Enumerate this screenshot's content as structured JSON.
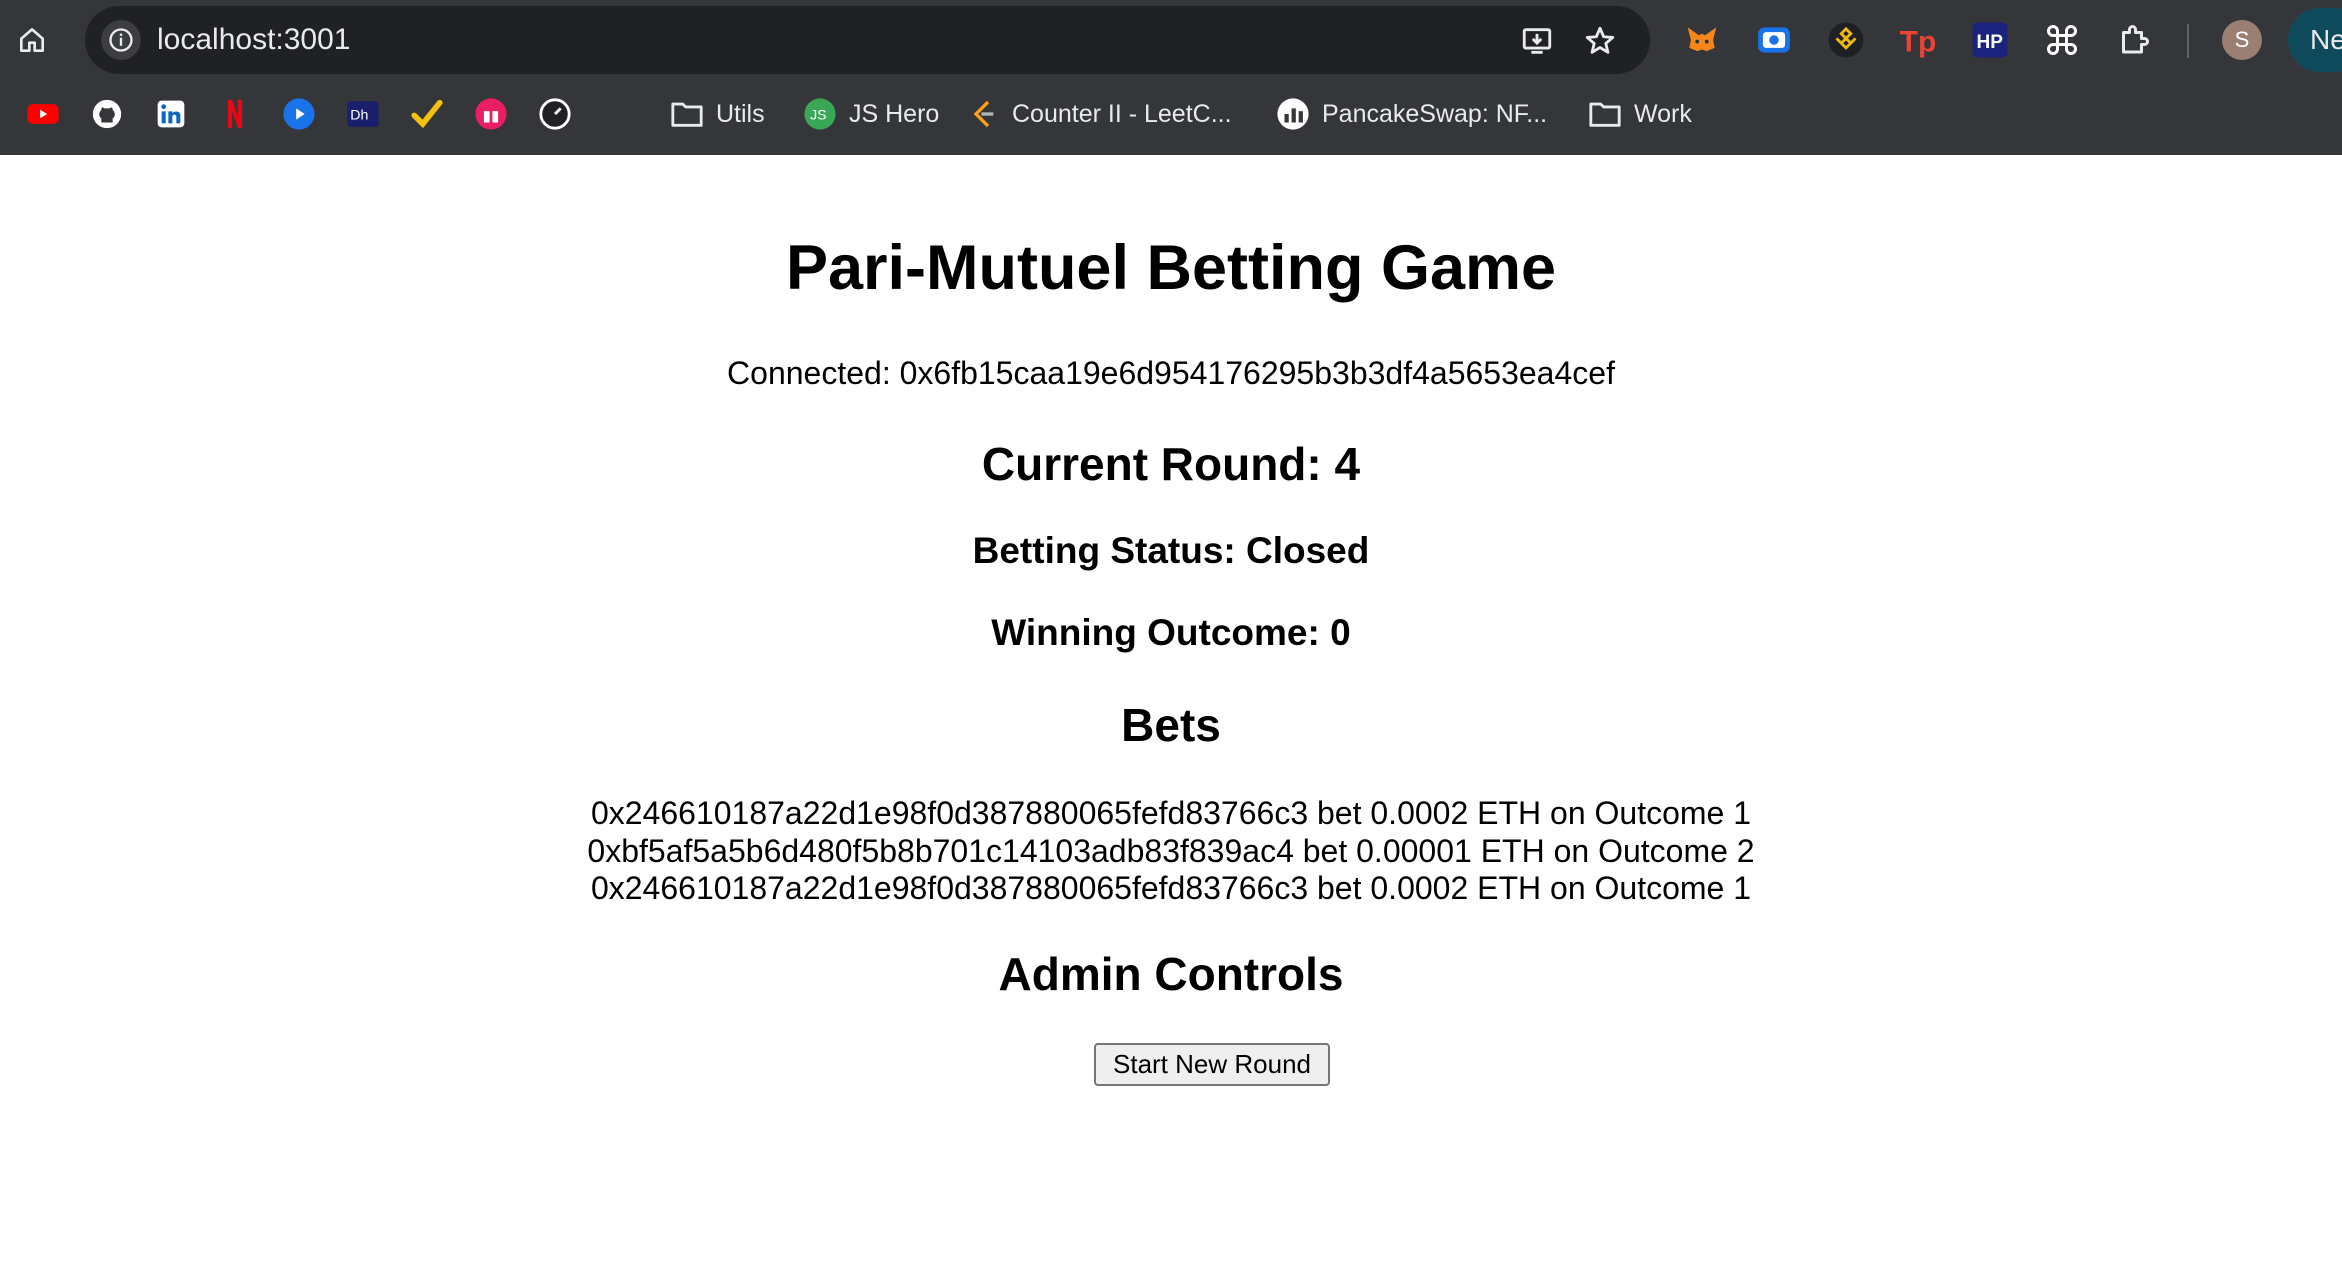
{
  "browser": {
    "url": "localhost:3001",
    "profile_initial": "S",
    "new_tab_label": "Ne",
    "bookmarks": [
      {
        "kind": "icon",
        "icon": "youtube-icon",
        "color": "#ff0000"
      },
      {
        "kind": "icon",
        "icon": "github-icon",
        "color": "#ffffff"
      },
      {
        "kind": "icon",
        "icon": "linkedin-icon",
        "color": "#0a66c2"
      },
      {
        "kind": "icon",
        "icon": "netflix-icon",
        "color": "#e50914"
      },
      {
        "kind": "icon",
        "icon": "play-icon",
        "color": "#1a73e8"
      },
      {
        "kind": "icon",
        "icon": "dh-icon",
        "color": "#1a1f6b"
      },
      {
        "kind": "icon",
        "icon": "checkmark-icon",
        "color": "#f4c20d"
      },
      {
        "kind": "icon",
        "icon": "gift-icon",
        "color": "#e91e63"
      },
      {
        "kind": "icon",
        "icon": "speedometer-icon",
        "color": "#ffffff"
      },
      {
        "kind": "icon",
        "icon": "moon-icon",
        "color": "#3f51b5"
      },
      {
        "kind": "folder",
        "label": "Utils"
      },
      {
        "kind": "site",
        "label": "JS Hero",
        "icon": "js-hero-icon",
        "badge": "JS",
        "color": "#3aa757"
      },
      {
        "kind": "site",
        "label": "Counter II - LeetC...",
        "icon": "leetcode-icon",
        "color": "#ffa116"
      },
      {
        "kind": "site",
        "label": "PancakeSwap: NF...",
        "icon": "pancakeswap-icon",
        "color": "#d1884f"
      },
      {
        "kind": "folder",
        "label": "Work"
      }
    ],
    "extensions": [
      {
        "icon": "metamask-icon",
        "color": "#f6851b"
      },
      {
        "icon": "screen-capture-icon",
        "color": "#1a73e8"
      },
      {
        "icon": "binance-wallet-icon",
        "color": "#f0b90b"
      },
      {
        "icon": "tp-icon",
        "label": "Tp",
        "color": "#ea4335"
      },
      {
        "icon": "hp-icon",
        "label": "HP",
        "color": "#1a237e"
      },
      {
        "icon": "keyboard-command-icon",
        "color": "#ffffff"
      },
      {
        "icon": "extensions-puzzle-icon",
        "color": "#e8eaed"
      }
    ]
  },
  "page": {
    "title": "Pari-Mutuel Betting Game",
    "connected": "Connected: 0x6fb15caa19e6d954176295b3b3df4a5653ea4cef",
    "current_round": "Current Round: 4",
    "betting_status": "Betting Status: Closed",
    "winning_outcome": "Winning Outcome: 0",
    "bets_heading": "Bets",
    "bets": [
      "0x246610187a22d1e98f0d387880065fefd83766c3 bet 0.0002 ETH on Outcome 1",
      "0xbf5af5a5b6d480f5b8b701c14103adb83f839ac4 bet 0.00001 ETH on Outcome 2",
      "0x246610187a22d1e98f0d387880065fefd83766c3 bet 0.0002 ETH on Outcome 1"
    ],
    "admin_heading": "Admin Controls",
    "start_button": "Start New Round"
  }
}
